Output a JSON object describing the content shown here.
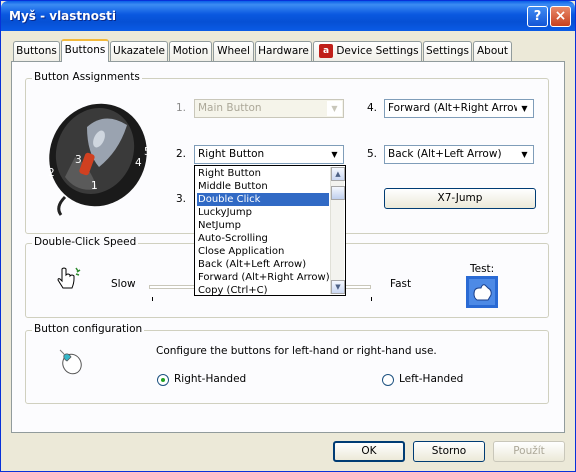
{
  "window": {
    "title": "Myš - vlastnosti",
    "help_glyph": "?",
    "close_glyph": "×"
  },
  "tabs": [
    {
      "label": "Buttons"
    },
    {
      "label": "Buttons",
      "active": true
    },
    {
      "label": "Ukazatele"
    },
    {
      "label": "Motion"
    },
    {
      "label": "Wheel"
    },
    {
      "label": "Hardware"
    },
    {
      "label": "Device Settings",
      "icon": "device-settings-icon"
    },
    {
      "label": "Settings"
    },
    {
      "label": "About"
    }
  ],
  "button_assignments": {
    "title": "Button Assignments",
    "mouse_labels": [
      "1",
      "2",
      "3",
      "4",
      "5"
    ],
    "rows": [
      {
        "number": "1.",
        "value": "Main Button",
        "disabled": true
      },
      {
        "number": "2.",
        "value": "Right Button"
      },
      {
        "number": "3.",
        "value": ""
      },
      {
        "number": "4.",
        "value": "Forward (Alt+Right Arrow)"
      },
      {
        "number": "5.",
        "value": "Back (Alt+Left Arrow)"
      }
    ],
    "x7_button": "X7-Jump",
    "dropdown": {
      "selected_index": 2,
      "options": [
        "Right Button",
        "Middle Button",
        "Double Click",
        "LuckyJump",
        "NetJump",
        "Auto-Scrolling",
        "Close Application",
        "Back (Alt+Left Arrow)",
        "Forward (Alt+Right Arrow)",
        "Copy (Ctrl+C)"
      ]
    }
  },
  "double_click": {
    "title": "Double-Click Speed",
    "slow": "Slow",
    "fast": "Fast",
    "test": "Test:"
  },
  "button_config": {
    "title": "Button configuration",
    "description": "Configure the buttons for left-hand or right-hand use.",
    "right_handed": "Right-Handed",
    "left_handed": "Left-Handed",
    "selected": "right"
  },
  "footer": {
    "ok": "OK",
    "cancel": "Storno",
    "apply": "Použít"
  },
  "colors": {
    "title_bar": "#0a58e0",
    "selection": "#316ac5",
    "tab_highlight": "#f3b93b"
  }
}
